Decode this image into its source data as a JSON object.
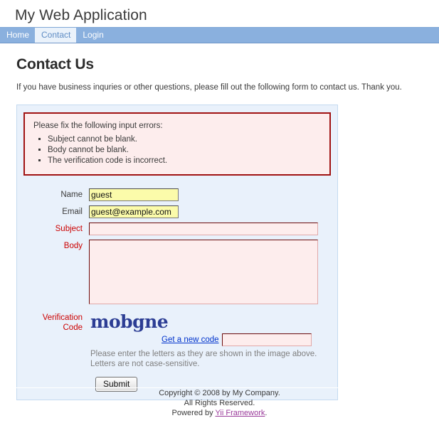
{
  "header": {
    "site_title": "My Web Application"
  },
  "nav": {
    "items": [
      {
        "label": "Home",
        "active": false
      },
      {
        "label": "Contact",
        "active": true
      },
      {
        "label": "Login",
        "active": false
      }
    ]
  },
  "main": {
    "heading": "Contact Us",
    "intro": "If you have business inquries or other questions, please fill out the following form to contact us. Thank you."
  },
  "errors": {
    "title": "Please fix the following input errors:",
    "items": [
      "Subject cannot be blank.",
      "Body cannot be blank.",
      "The verification code is incorrect."
    ]
  },
  "form": {
    "name": {
      "label": "Name",
      "value": "guest",
      "placeholder": ""
    },
    "email": {
      "label": "Email",
      "value": "guest@example.com",
      "placeholder": ""
    },
    "subject": {
      "label": "Subject",
      "value": "",
      "placeholder": ""
    },
    "body": {
      "label": "Body",
      "value": "",
      "placeholder": ""
    },
    "verification": {
      "label_line1": "Verification",
      "label_line2": "Code",
      "captcha_text": "mobgne",
      "refresh_link": "Get a new code",
      "value": "",
      "placeholder": "",
      "hint_line1": "Please enter the letters as they are shown in the image above.",
      "hint_line2": "Letters are not case-sensitive."
    },
    "submit_label": "Submit"
  },
  "footer": {
    "copyright": "Copyright © 2008 by My Company.",
    "rights": "All Rights Reserved.",
    "powered_prefix": "Powered by ",
    "powered_link": "Yii Framework",
    "powered_suffix": "."
  },
  "colors": {
    "nav_bar": "#8ab0de",
    "active_tab_bg": "#eaf2fb",
    "active_tab_text": "#5f8cc4",
    "form_bg": "#e9f1fb",
    "form_border": "#c4daf0",
    "error_border": "#a01212",
    "error_bg": "#fdeded",
    "error_label": "#cc0000",
    "autofill_bg": "#fbfbaa",
    "captcha_color": "#2c3d94",
    "link_blue": "#0033cc",
    "footer_link": "#9a3a9a"
  }
}
